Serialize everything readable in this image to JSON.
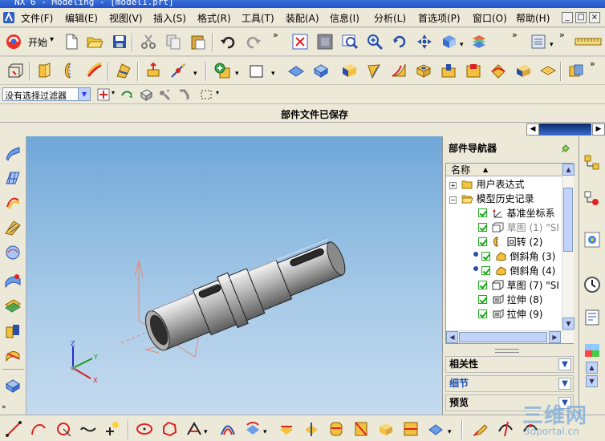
{
  "window": {
    "title": "NX 6 - Modeling - [model1.prt]",
    "controls": [
      "_",
      "□",
      "×"
    ]
  },
  "menubar": {
    "items": [
      "文件(F)",
      "编辑(E)",
      "视图(V)",
      "插入(S)",
      "格式(R)",
      "工具(T)",
      "装配(A)",
      "信息(I)",
      "分析(L)",
      "首选项(P)",
      "窗口(O)",
      "帮助(H)"
    ]
  },
  "toolbar": {
    "start_label": "开始",
    "dropdown_glyph": "▾",
    "overflow_glyph": "»"
  },
  "filterbar": {
    "selection_filter": "没有选择过滤器",
    "dropdown_glyph": "▼"
  },
  "status": {
    "message": "部件文件已保存"
  },
  "viewport": {
    "axis_labels": {
      "x": "X",
      "y": "Y",
      "z": "Z"
    },
    "background_top": "#6fa7d8",
    "background_bottom": "#c5dbef"
  },
  "navigator": {
    "title": "部件导航器",
    "column_header": "名称",
    "sort_glyph": "▲",
    "tree": [
      {
        "label": "用户表达式",
        "expander": "+",
        "icon": "folder-icon",
        "level": 0,
        "grayed": false
      },
      {
        "label": "模型历史记录",
        "expander": "−",
        "icon": "folder-open-icon",
        "level": 0,
        "grayed": false
      },
      {
        "label": "基准坐标系",
        "icon": "datum-csys-icon",
        "level": 1,
        "grayed": false
      },
      {
        "label": "草图 (1) \"SI",
        "icon": "sketch-icon",
        "level": 1,
        "grayed": true
      },
      {
        "label": "回转 (2)",
        "icon": "revolve-icon",
        "level": 1,
        "grayed": false
      },
      {
        "label": "倒斜角 (3)",
        "icon": "chamfer-icon",
        "level": 1,
        "grayed": false
      },
      {
        "label": "倒斜角 (4)",
        "icon": "chamfer-icon",
        "level": 1,
        "grayed": false
      },
      {
        "label": "草图 (7) \"SI",
        "icon": "sketch-icon",
        "level": 1,
        "grayed": false
      },
      {
        "label": "拉伸 (8)",
        "icon": "extrude-icon",
        "level": 1,
        "grayed": false
      },
      {
        "label": "拉伸 (9)",
        "icon": "extrude-icon",
        "level": 1,
        "grayed": false
      }
    ],
    "panels": [
      {
        "label": "相关性",
        "color": "#000000"
      },
      {
        "label": "细节",
        "color": "#1a4fb8"
      },
      {
        "label": "预览",
        "color": "#000000"
      }
    ]
  },
  "scroll": {
    "up": "▲",
    "down": "▼",
    "left": "◀",
    "right": "▶"
  },
  "watermark": {
    "main": "三维网",
    "sub": "3dportal.cn"
  }
}
